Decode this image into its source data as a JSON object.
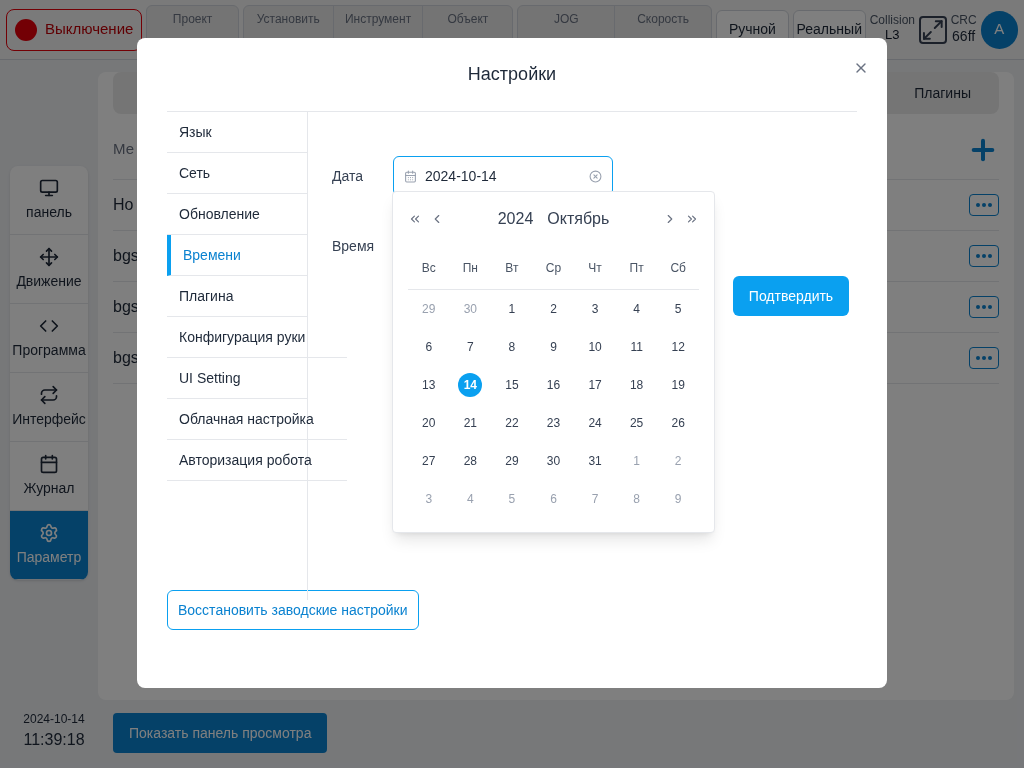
{
  "top_bar": {
    "power": {
      "label": "Выключение",
      "on": false
    },
    "groups": [
      [
        {
          "label": "Проект"
        }
      ],
      [
        {
          "label": "Установить"
        },
        {
          "label": "Инструмент"
        },
        {
          "label": "Объект"
        }
      ],
      [
        {
          "label": "JOG"
        },
        {
          "label": "Скорость"
        }
      ]
    ],
    "mode_buttons": [
      "Ручной",
      "Реальный"
    ],
    "collision": {
      "label": "Collision",
      "value": "L3"
    },
    "crc": {
      "label": "CRC",
      "value": "66ff"
    },
    "avatar": "A"
  },
  "sidebar": {
    "items": [
      {
        "label": "панель",
        "selected": false
      },
      {
        "label": "Движение",
        "selected": false
      },
      {
        "label": "Программа",
        "selected": false
      },
      {
        "label": "Интерфейс",
        "selected": false
      },
      {
        "label": "Журнал",
        "selected": false
      },
      {
        "label": "Параметр",
        "selected": true
      }
    ]
  },
  "clock": {
    "date": "2024-10-14",
    "time": "11:39:18"
  },
  "panel": {
    "tabs": [
      {
        "label": "Плагины",
        "selected": false
      }
    ],
    "header": "Ме",
    "rows": [
      "Ho",
      "bgs",
      "bgs",
      "bgs"
    ]
  },
  "preview_button": "Показать панель просмотра",
  "dialog": {
    "title": "Настройки",
    "menu": [
      {
        "label": "Язык",
        "selected": false
      },
      {
        "label": "Сеть",
        "selected": false
      },
      {
        "label": "Обновление",
        "selected": false
      },
      {
        "label": "Времени",
        "selected": true
      },
      {
        "label": "Плагина",
        "selected": false
      },
      {
        "label": "Конфигурация руки",
        "selected": false
      },
      {
        "label": "UI Setting",
        "selected": false
      },
      {
        "label": "Облачная настройка",
        "selected": false
      },
      {
        "label": "Авторизация робота",
        "selected": false
      }
    ],
    "date_label": "Дата",
    "date_value": "2024-10-14",
    "time_label": "Время",
    "confirm": "Подтвердить",
    "reset": "Восстановить заводские настройки",
    "calendar": {
      "year": "2024",
      "month": "Октябрь",
      "weekdays": [
        "Вс",
        "Пн",
        "Вт",
        "Ср",
        "Чт",
        "Пт",
        "Сб"
      ],
      "weeks": [
        [
          {
            "day": "29",
            "in_month": false,
            "selected": false
          },
          {
            "day": "30",
            "in_month": false,
            "selected": false
          },
          {
            "day": "1",
            "in_month": true,
            "selected": false
          },
          {
            "day": "2",
            "in_month": true,
            "selected": false
          },
          {
            "day": "3",
            "in_month": true,
            "selected": false
          },
          {
            "day": "4",
            "in_month": true,
            "selected": false
          },
          {
            "day": "5",
            "in_month": true,
            "selected": false
          }
        ],
        [
          {
            "day": "6",
            "in_month": true,
            "selected": false
          },
          {
            "day": "7",
            "in_month": true,
            "selected": false
          },
          {
            "day": "8",
            "in_month": true,
            "selected": false
          },
          {
            "day": "9",
            "in_month": true,
            "selected": false
          },
          {
            "day": "10",
            "in_month": true,
            "selected": false
          },
          {
            "day": "11",
            "in_month": true,
            "selected": false
          },
          {
            "day": "12",
            "in_month": true,
            "selected": false
          }
        ],
        [
          {
            "day": "13",
            "in_month": true,
            "selected": false
          },
          {
            "day": "14",
            "in_month": true,
            "selected": true
          },
          {
            "day": "15",
            "in_month": true,
            "selected": false
          },
          {
            "day": "16",
            "in_month": true,
            "selected": false
          },
          {
            "day": "17",
            "in_month": true,
            "selected": false
          },
          {
            "day": "18",
            "in_month": true,
            "selected": false
          },
          {
            "day": "19",
            "in_month": true,
            "selected": false
          }
        ],
        [
          {
            "day": "20",
            "in_month": true,
            "selected": false
          },
          {
            "day": "21",
            "in_month": true,
            "selected": false
          },
          {
            "day": "22",
            "in_month": true,
            "selected": false
          },
          {
            "day": "23",
            "in_month": true,
            "selected": false
          },
          {
            "day": "24",
            "in_month": true,
            "selected": false
          },
          {
            "day": "25",
            "in_month": true,
            "selected": false
          },
          {
            "day": "26",
            "in_month": true,
            "selected": false
          }
        ],
        [
          {
            "day": "27",
            "in_month": true,
            "selected": false
          },
          {
            "day": "28",
            "in_month": true,
            "selected": false
          },
          {
            "day": "29",
            "in_month": true,
            "selected": false
          },
          {
            "day": "30",
            "in_month": true,
            "selected": false
          },
          {
            "day": "31",
            "in_month": true,
            "selected": false
          },
          {
            "day": "1",
            "in_month": false,
            "selected": false
          },
          {
            "day": "2",
            "in_month": false,
            "selected": false
          }
        ],
        [
          {
            "day": "3",
            "in_month": false,
            "selected": false
          },
          {
            "day": "4",
            "in_month": false,
            "selected": false
          },
          {
            "day": "5",
            "in_month": false,
            "selected": false
          },
          {
            "day": "6",
            "in_month": false,
            "selected": false
          },
          {
            "day": "7",
            "in_month": false,
            "selected": false
          },
          {
            "day": "8",
            "in_month": false,
            "selected": false
          },
          {
            "day": "9",
            "in_month": false,
            "selected": false
          }
        ]
      ]
    }
  }
}
